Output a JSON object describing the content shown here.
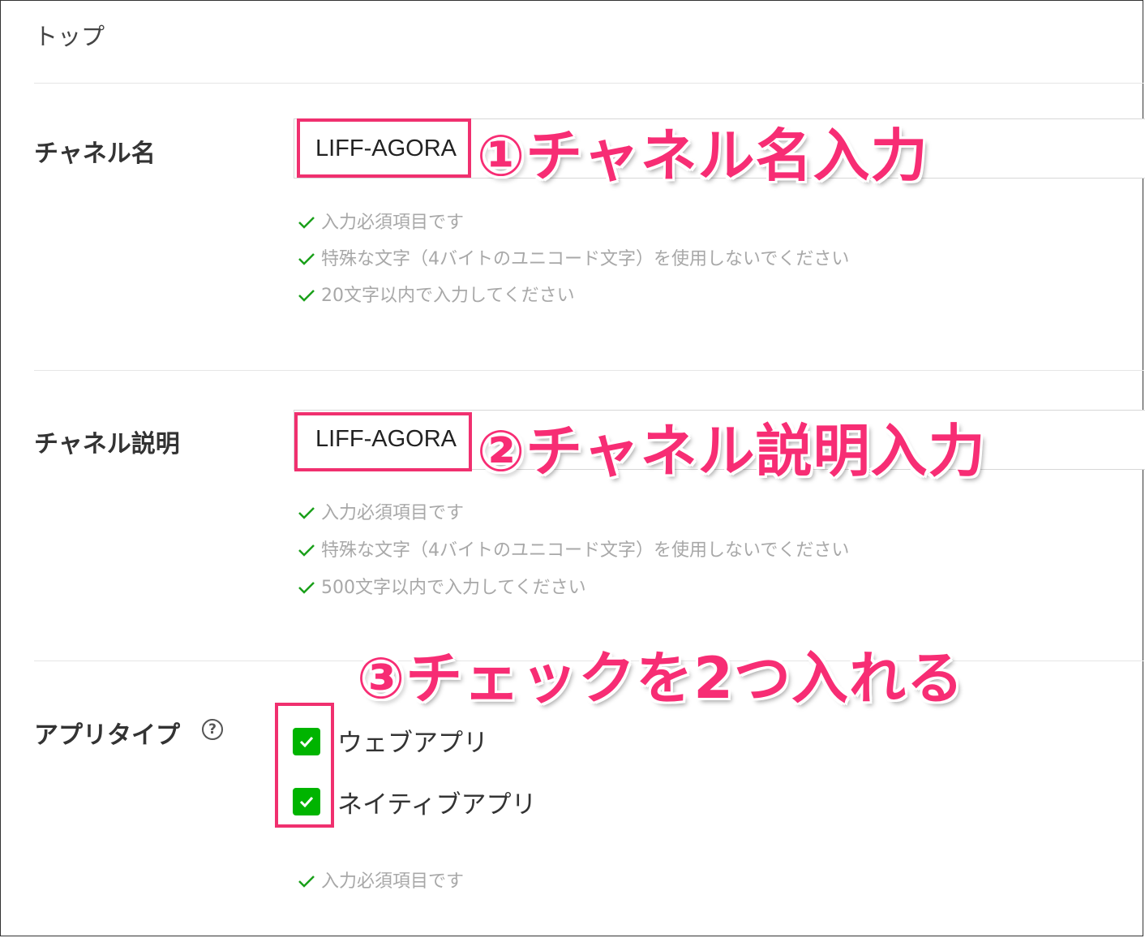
{
  "breadcrumb": "トップ",
  "channel_name": {
    "label": "チャネル名",
    "value": "LIFF-AGORA",
    "annotation": "①チャネル名入力",
    "hints": [
      "入力必須項目です",
      "特殊な文字（4バイトのユニコード文字）を使用しないでください",
      "20文字以内で入力してください"
    ]
  },
  "channel_description": {
    "label": "チャネル説明",
    "value": "LIFF-AGORA",
    "annotation": "②チャネル説明入力",
    "hints": [
      "入力必須項目です",
      "特殊な文字（4バイトのユニコード文字）を使用しないでください",
      "500文字以内で入力してください"
    ]
  },
  "app_type": {
    "label": "アプリタイプ",
    "help_icon": "?",
    "annotation": "③チェックを2つ入れる",
    "options": [
      {
        "label": "ウェブアプリ",
        "checked": true
      },
      {
        "label": "ネイティブアプリ",
        "checked": true
      }
    ],
    "hints": [
      "入力必須項目です"
    ]
  },
  "colors": {
    "annotation": "#f72d74",
    "checkbox": "#00b400",
    "hint_check": "#1aa01a",
    "hint_text": "#a8a8a8"
  }
}
